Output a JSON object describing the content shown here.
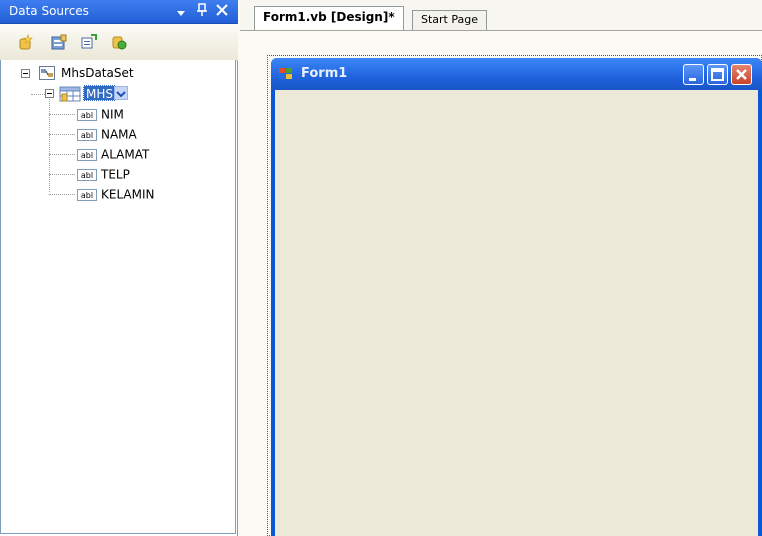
{
  "data_sources": {
    "title": "Data Sources",
    "tree": {
      "dataset": "MhsDataSet",
      "table": "MHS",
      "fields": [
        "NIM",
        "NAMA",
        "ALAMAT",
        "TELP",
        "KELAMIN"
      ],
      "field_icon_text": "abl"
    },
    "toolbar_icons": [
      "add-new-data-source-icon",
      "edit-dataset-icon",
      "configure-dataset-icon",
      "refresh-icon"
    ]
  },
  "tabs": [
    {
      "label": "Form1.vb [Design]*",
      "active": true
    },
    {
      "label": "Start Page",
      "active": false
    }
  ],
  "form": {
    "title": "Form1"
  },
  "colors": {
    "title_bar": "#225fd6",
    "form_client": "#ece9d8",
    "xp_blue": "#0b57d6",
    "close_red": "#c7442a"
  }
}
